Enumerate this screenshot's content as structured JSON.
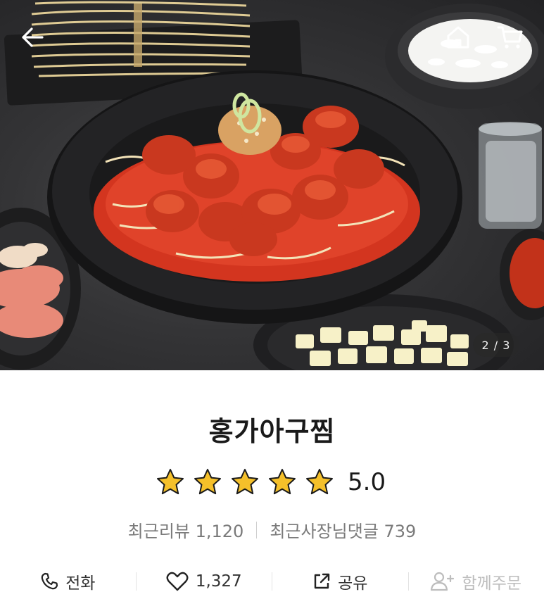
{
  "hero": {
    "page_counter": "2 / 3"
  },
  "header": {
    "back_icon": "arrow-left-icon",
    "home_icon": "home-icon",
    "cart_icon": "cart-icon"
  },
  "store": {
    "name": "홍가아구찜",
    "rating": {
      "stars_filled": 5,
      "stars_total": 5,
      "value": "5.0",
      "star_color": "#f5c02a"
    },
    "recent_reviews_label": "최근리뷰 1,120",
    "recent_owner_comments_label": "최근사장님댓글 739"
  },
  "actions": [
    {
      "icon": "phone-icon",
      "label": "전화",
      "enabled": true
    },
    {
      "icon": "heart-icon",
      "label": "1,327",
      "enabled": true
    },
    {
      "icon": "share-icon",
      "label": "공유",
      "enabled": true
    },
    {
      "icon": "add-person-icon",
      "label": "함께주문",
      "enabled": false
    }
  ]
}
